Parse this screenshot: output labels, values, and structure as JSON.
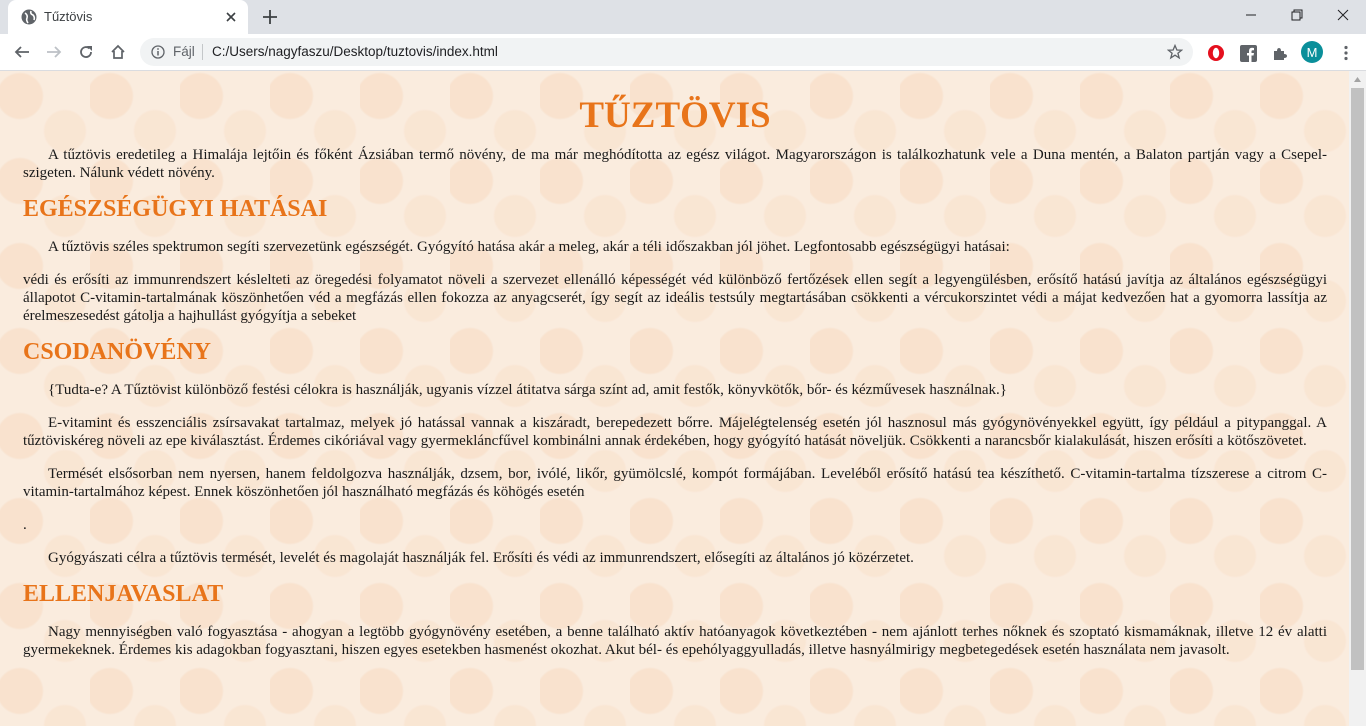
{
  "browser": {
    "tab_title": "Tűztövis",
    "scheme_label": "Fájl",
    "url": "C:/Users/nagyfaszu/Desktop/tuztovis/index.html",
    "avatar_letter": "M"
  },
  "page": {
    "title": "TŰZTÖVIS",
    "intro": "A tűztövis eredetileg a Himalája lejtőin és főként Ázsiában termő növény, de ma már meghódította az egész világot. Magyarországon is találkozhatunk vele a Duna mentén, a Balaton partján vagy a Csepel-szigeten. Nálunk védett növény.",
    "sections": [
      {
        "heading": "EGÉSZSÉGÜGYI HATÁSAI",
        "paragraphs": [
          "A tűztövis széles spektrumon segíti szervezetünk egészségét. Gyógyító hatása akár a meleg, akár a téli időszakban jól jöhet. Legfontosabb egészségügyi hatásai:",
          "védi és erősíti az immunrendszert késlelteti az öregedési folyamatot növeli a szervezet ellenálló képességét véd különböző fertőzések ellen segít a legyengülésben, erősítő hatású javítja az általános egészségügyi állapotot C-vitamin-tartalmának köszönhetően véd a megfázás ellen fokozza az anyagcserét, így segít az ideális testsúly megtartásában csökkenti a vércukorszintet védi a májat kedvezően hat a gyomorra lassítja az érelmeszesedést gátolja a hajhullást gyógyítja a sebeket"
        ]
      },
      {
        "heading": "CSODANÖVÉNY",
        "paragraphs": [
          "{Tudta-e? A Tűztövist különböző festési célokra is használják, ugyanis vízzel átitatva sárga színt ad, amit festők, könyvkötők, bőr- és kézművesek használnak.}",
          "E-vitamint és esszenciális zsírsavakat tartalmaz, melyek jó hatással vannak a kiszáradt, berepedezett bőrre. Májelégtelenség esetén jól hasznosul más gyógynövényekkel együtt, így például a pitypanggal. A tűztöviskéreg növeli az epe kiválasztást. Érdemes cikóriával vagy gyermekláncfűvel kombinálni annak érdekében, hogy gyógyító hatását növeljük. Csökkenti a narancsbőr kialakulását, hiszen erősíti a kötőszövetet.",
          "Termését elsősorban nem nyersen, hanem feldolgozva használják, dzsem, bor, ivólé, likőr, gyümölcslé, kompót formájában. Leveléből erősítő hatású tea készíthető. C-vitamin-tartalma tízszerese a citrom C-vitamin-tartalmához képest. Ennek köszönhetően jól használható megfázás és köhögés esetén",
          ".",
          "Gyógyászati célra a tűztövis termését, levelét és magolaját használják fel. Erősíti és védi az immunrendszert, elősegíti az általános jó közérzetet."
        ]
      },
      {
        "heading": "ELLENJAVASLAT",
        "paragraphs": [
          "Nagy mennyiségben való fogyasztása - ahogyan a legtöbb gyógynövény esetében, a benne található aktív hatóanyagok következtében - nem ajánlott terhes nőknek és szoptató kismamáknak, illetve 12 év alatti gyermekeknek. Érdemes kis adagokban fogyasztani, hiszen egyes esetekben hasmenést okozhat. Akut bél- és epehólyaggyulladás, illetve hasnyálmirigy megbetegedések esetén használata nem javasolt."
        ]
      }
    ]
  },
  "colors": {
    "heading": "#e8741a",
    "tabstrip": "#dee1e6",
    "avatar": "#0a8f9a"
  }
}
